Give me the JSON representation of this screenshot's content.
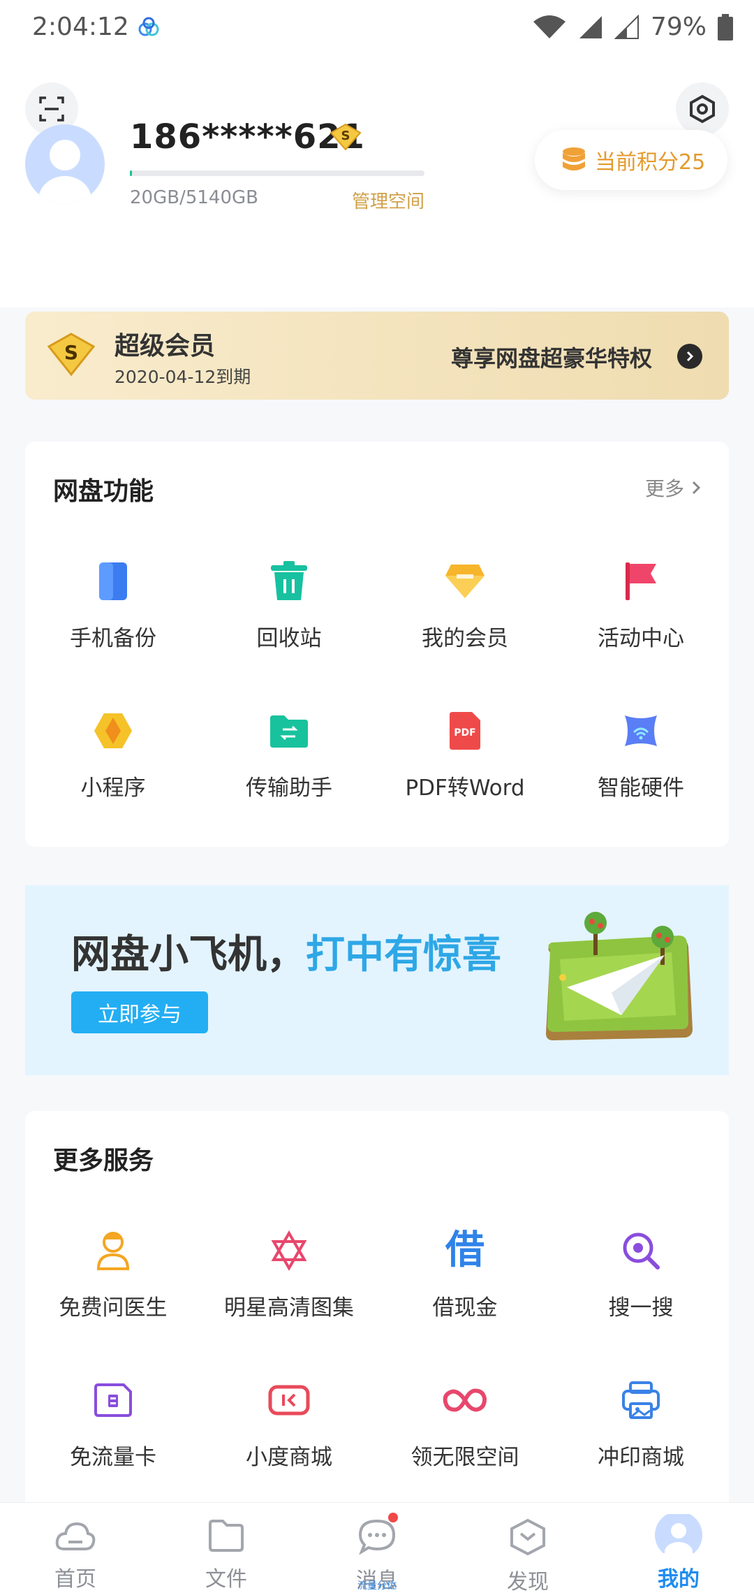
{
  "status_bar": {
    "time": "2:04:12",
    "battery": "79%"
  },
  "profile": {
    "phone": "186*****621",
    "storage_used_fraction": 0.004,
    "storage_text": "20GB/5140GB",
    "manage_label": "管理空间",
    "points_label": "当前积分25"
  },
  "vip": {
    "title": "超级会员",
    "expiry": "2020-04-12到期",
    "slogan": "尊享网盘超豪华特权"
  },
  "features": {
    "title": "网盘功能",
    "more_label": "更多",
    "items": [
      {
        "label": "手机备份",
        "icon": "phone-backup-icon"
      },
      {
        "label": "回收站",
        "icon": "trash-icon"
      },
      {
        "label": "我的会员",
        "icon": "diamond-icon"
      },
      {
        "label": "活动中心",
        "icon": "flag-icon"
      },
      {
        "label": "小程序",
        "icon": "mini-program-icon"
      },
      {
        "label": "传输助手",
        "icon": "transfer-folder-icon"
      },
      {
        "label": "PDF转Word",
        "icon": "pdf-icon"
      },
      {
        "label": "智能硬件",
        "icon": "smart-hardware-icon"
      }
    ]
  },
  "promo": {
    "title_main": "网盘小飞机，",
    "title_accent": "打中有惊喜",
    "button_label": "立即参与"
  },
  "services": {
    "title": "更多服务",
    "items": [
      {
        "label": "免费问医生",
        "icon": "doctor-icon"
      },
      {
        "label": "明星高清图集",
        "icon": "star-gallery-icon"
      },
      {
        "label": "借现金",
        "icon": "borrow-cash-icon",
        "glyph": "借"
      },
      {
        "label": "搜一搜",
        "icon": "search-icon"
      },
      {
        "label": "免流量卡",
        "icon": "sim-card-icon"
      },
      {
        "label": "小度商城",
        "icon": "xiaodu-store-icon"
      },
      {
        "label": "领无限空间",
        "icon": "infinity-icon"
      },
      {
        "label": "冲印商城",
        "icon": "print-store-icon"
      }
    ]
  },
  "nav": {
    "items": [
      {
        "label": "首页",
        "icon": "cloud-icon"
      },
      {
        "label": "文件",
        "icon": "folder-icon"
      },
      {
        "label": "消息",
        "icon": "chat-icon",
        "sub": "流量分佐"
      },
      {
        "label": "发现",
        "icon": "discover-icon"
      },
      {
        "label": "我的",
        "icon": "profile-icon"
      }
    ]
  },
  "colors": {
    "accent_blue": "#2ea7e6",
    "gold": "#d1a048",
    "points_orange": "#e39a2c",
    "nav_active": "#1f8cf0"
  }
}
